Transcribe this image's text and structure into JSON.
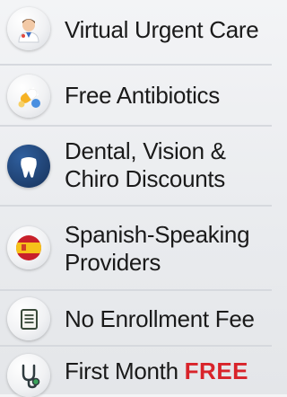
{
  "features": [
    {
      "icon": "doctor-icon",
      "lines": [
        "Virtual Urgent Care"
      ]
    },
    {
      "icon": "pills-icon",
      "lines": [
        "Free Antibiotics"
      ]
    },
    {
      "icon": "tooth-icon",
      "lines": [
        "Dental, Vision &",
        "Chiro Discounts"
      ]
    },
    {
      "icon": "spain-flag-icon",
      "lines": [
        "Spanish-Speaking",
        "Providers"
      ]
    },
    {
      "icon": "document-icon",
      "lines": [
        "No Enrollment Fee"
      ]
    },
    {
      "icon": "stethoscope-icon",
      "lines": [
        "First Month"
      ],
      "highlight": "FREE"
    }
  ],
  "colors": {
    "highlight": "#d8232a",
    "background": "#eceef1",
    "divider": "#d6d9de"
  }
}
